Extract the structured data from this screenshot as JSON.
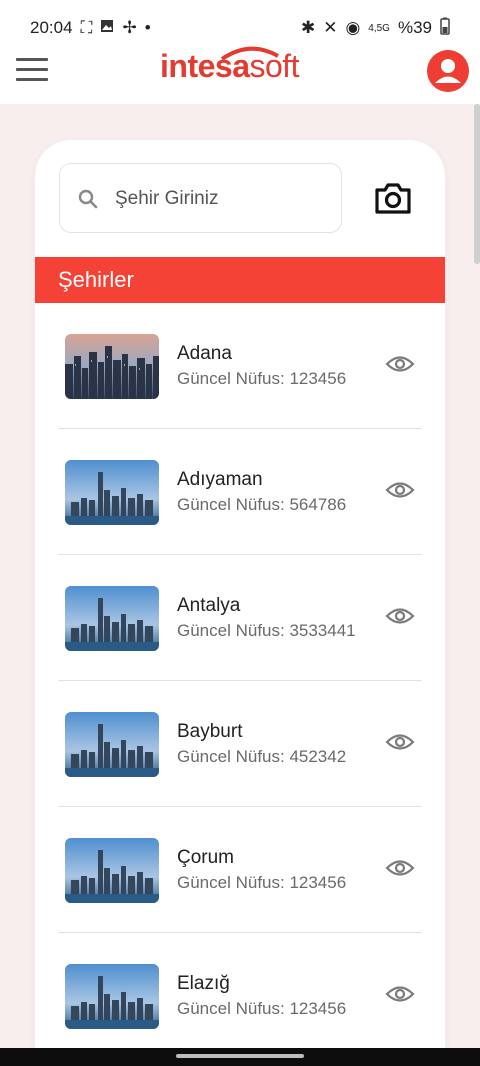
{
  "status_bar": {
    "time": "20:04",
    "network": "4,5G",
    "battery": "%39"
  },
  "app_bar": {
    "logo_part1": "intesa",
    "logo_part2": "soft"
  },
  "search": {
    "placeholder": "Şehir Giriniz"
  },
  "section_title": "Şehirler",
  "cities": [
    {
      "name": "Adana",
      "population_label": "Güncel Nüfus: 123456"
    },
    {
      "name": "Adıyaman",
      "population_label": "Güncel Nüfus: 564786"
    },
    {
      "name": "Antalya",
      "population_label": "Güncel Nüfus: 3533441"
    },
    {
      "name": "Bayburt",
      "population_label": "Güncel Nüfus: 452342"
    },
    {
      "name": "Çorum",
      "population_label": "Güncel Nüfus: 123456"
    },
    {
      "name": "Elazığ",
      "population_label": "Güncel Nüfus: 123456"
    }
  ],
  "colors": {
    "accent": "#f44336",
    "logo": "#e53a2f",
    "background": "#f8eeee"
  }
}
